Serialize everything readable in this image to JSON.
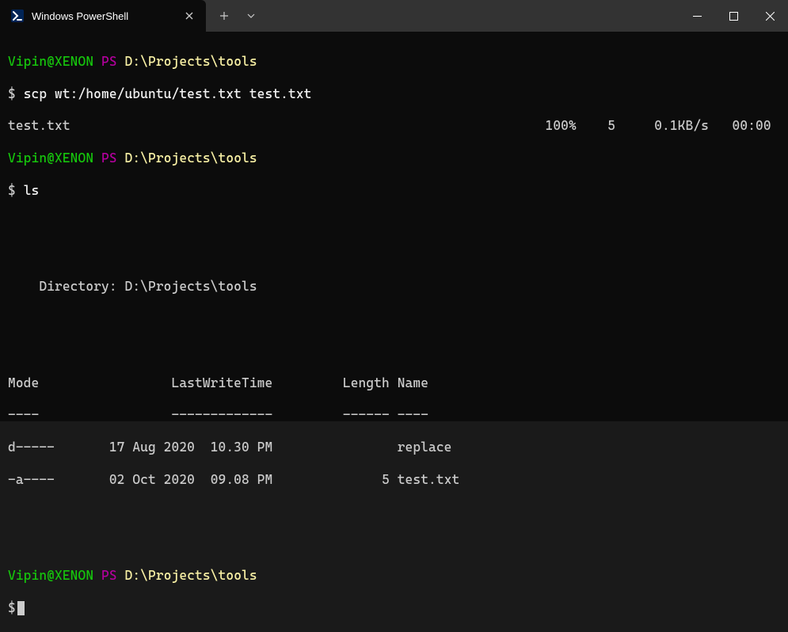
{
  "titlebar": {
    "tab_title": "Windows PowerShell",
    "tab_icon_glyph": ">_"
  },
  "prompt": {
    "user_host": "Vipin@XENON",
    "ps_label": "PS",
    "path": "D:\\Projects\\tools",
    "symbol": "$"
  },
  "lines": {
    "cmd1": "scp wt:/home/ubuntu/test.txt test.txt",
    "transfer_file": "test.txt",
    "transfer_pct": "100%",
    "transfer_bytes": "5",
    "transfer_rate": "0.1KB/s",
    "transfer_time": "00:00",
    "cmd2": "ls",
    "dir_header_label": "    Directory:",
    "dir_header_path": "D:\\Projects\\tools",
    "cols": {
      "mode": "Mode",
      "lwt": "LastWriteTime",
      "len": "Length",
      "name": "Name"
    },
    "rules": {
      "mode": "----",
      "lwt": "-------------",
      "len": "------",
      "name": "----"
    },
    "rows": [
      {
        "mode": "d-----",
        "date": "17 Aug 2020",
        "time": "10.30 PM",
        "len": "",
        "name": "replace"
      },
      {
        "mode": "-a----",
        "date": "02 Oct 2020",
        "time": "09.08 PM",
        "len": "5",
        "name": "test.txt"
      }
    ]
  }
}
